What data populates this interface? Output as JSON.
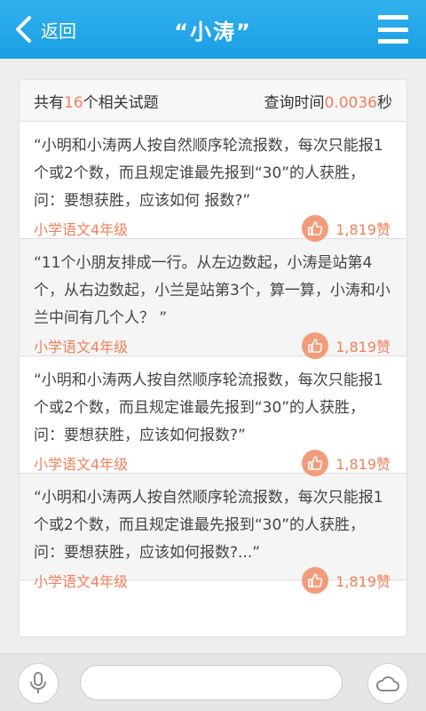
{
  "header": {
    "back_label": "返回",
    "title": "“小涛”"
  },
  "summary": {
    "prefix": "共有",
    "count": "16",
    "suffix": "个相关试题",
    "time_label": "查询时间",
    "time_value": "0.0036",
    "time_unit": "秒"
  },
  "questions": [
    {
      "text": "“小明和小涛两人按自然顺序轮流报数，每次只能报1个或2个数，而且规定谁最先报到“30”的人获胜，问：要想获胜，应该如何 报数?”",
      "grade": "小学语文4年级",
      "likes": "1,819赞"
    },
    {
      "text": "“11个小朋友排成一行。从左边数起，小涛是站第4个，从右边数起，小兰是站第3个，算一算，小涛和小兰中间有几个人？ ”",
      "grade": "小学语文4年级",
      "likes": "1,819赞"
    },
    {
      "text": "“小明和小涛两人按自然顺序轮流报数，每次只能报1个或2个数，而且规定谁最先报到“30”的人获胜，问：要想获胜，应该如何报数?”",
      "grade": "小学语文4年级",
      "likes": "1,819赞"
    },
    {
      "text": "“小明和小涛两人按自然顺序轮流报数，每次只能报1个或2个数，而且规定谁最先报到“30”的人获胜，问：要想获胜，应该如何报数?...”",
      "grade": "小学语文4年级",
      "likes": "1,819赞"
    }
  ],
  "bottom": {
    "input_value": "",
    "mic_icon": "mic-icon",
    "cloud_icon": "cloud-icon"
  },
  "colors": {
    "header": "#1a9fe3",
    "accent": "#f2805b"
  }
}
